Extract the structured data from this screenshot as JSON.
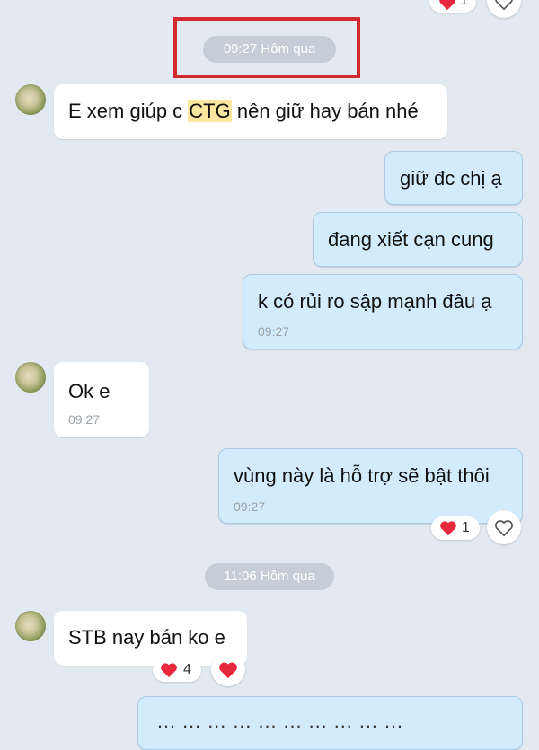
{
  "top": {
    "reaction_count": "1"
  },
  "separators": [
    {
      "label": "09:27 Hôm qua"
    },
    {
      "label": "11:06 Hôm qua"
    }
  ],
  "messages": [
    {
      "pre": "E xem giúp c ",
      "highlight": "CTG",
      "post": " nên giữ hay bán nhé"
    },
    {
      "text": "giữ đc chị ạ"
    },
    {
      "text": "đang xiết cạn cung"
    },
    {
      "text": "k có rủi ro sập mạnh đâu ạ",
      "time": "09:27"
    },
    {
      "text": "Ok e",
      "time": "09:27"
    },
    {
      "text": "vùng này là hỗ trợ sẽ bật thôi",
      "time": "09:27",
      "reaction_count": "1"
    },
    {
      "text": "STB nay bán ko e",
      "reaction_count": "4"
    },
    {
      "text": "… … … … … … … … … …"
    }
  ],
  "icons": {
    "heart_filled": "heart-icon",
    "heart_outline": "heart-outline-icon",
    "avatar": "avatar"
  },
  "colors": {
    "background": "#e2e9f1",
    "sent_bubble": "#d3ecfd",
    "received_bubble": "#ffffff",
    "highlight": "#fbe7a0",
    "annotation_box": "#d6282f",
    "heart": "#e8293d"
  }
}
